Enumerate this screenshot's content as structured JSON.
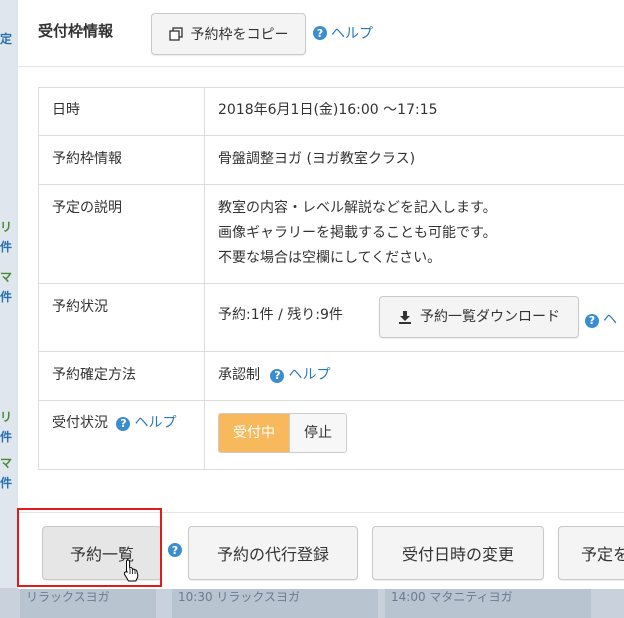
{
  "background": {
    "left_fragments": [
      "定",
      "リ",
      "件",
      "マ",
      "件",
      "リ",
      "件",
      "マ",
      "件"
    ],
    "bottom_cells": [
      "リラックスヨガ",
      "10:30 リラックスヨガ",
      "14:00 マタニティヨガ"
    ]
  },
  "modal": {
    "title": "受付枠情報",
    "copy_button": "予約枠をコピー",
    "help_label": "ヘルプ"
  },
  "table": {
    "rows": [
      {
        "key": "日時",
        "value_lines": [
          "2018年6月1日(金)16:00 ～17:15"
        ]
      },
      {
        "key": "予約枠情報",
        "value_lines": [
          "骨盤調整ヨガ (ヨガ教室クラス)"
        ]
      },
      {
        "key": "予定の説明",
        "value_lines": [
          "教室の内容・レベル解説などを記入します。",
          "画像ギャラリーを掲載することも可能です。",
          "不要な場合は空欄にしてください。"
        ]
      },
      {
        "key": "予約状況",
        "value_lines": [
          "予約:1件 / 残り:9件"
        ]
      },
      {
        "key": "予約確定方法",
        "value_lines": [
          "承認制"
        ]
      },
      {
        "key": "受付状況",
        "value_lines": []
      }
    ],
    "download_button": "予約一覧ダウンロード",
    "status_help": "ヘ",
    "method_help": "ヘルプ",
    "reception_help": "ヘルプ",
    "toggle_on": "受付中",
    "toggle_off": "停止"
  },
  "footer": {
    "buttons": [
      "予約一覧",
      "予約の代行登録",
      "受付日時の変更",
      "予定を"
    ]
  },
  "colors": {
    "accent_orange": "#f7b95b",
    "help_blue": "#3c8dcd",
    "highlight_red": "#e01b1b"
  }
}
